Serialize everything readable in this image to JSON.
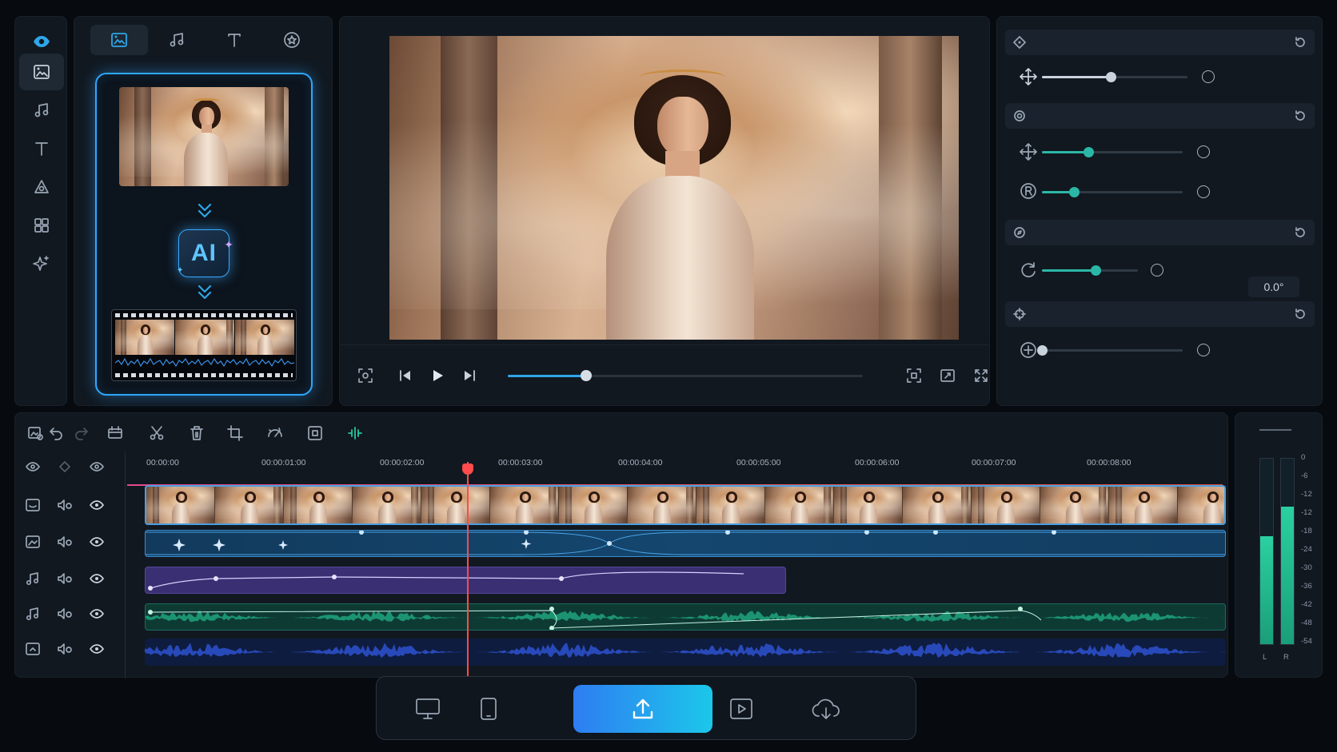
{
  "rail": {
    "items": [
      "eye-icon",
      "media-icon",
      "music-icon",
      "text-icon",
      "effects-icon",
      "templates-icon",
      "sparkle-icon"
    ],
    "active": "media-icon",
    "accent": "#2ea6e8"
  },
  "media_panel": {
    "tabs": [
      "image-icon",
      "music-icon",
      "text-icon",
      "sticker-icon"
    ],
    "active_tab": "image-icon",
    "ai_badge": "AI"
  },
  "timeline": {
    "ruler": [
      "00:00:00",
      "00:00:01:00",
      "00:00:02:00",
      "00:00:03:00",
      "00:00:04:00",
      "00:00:05:00",
      "00:00:06:00",
      "00:00:07:00",
      "00:00:08:00"
    ],
    "tracks": [
      "video",
      "effects",
      "music",
      "audio",
      "voiceover"
    ]
  },
  "properties": {
    "rotation_value": "0.0°",
    "sliders": [
      {
        "name": "position",
        "value": 0.47,
        "color": "#c9d3de"
      },
      {
        "name": "scale",
        "value": 0.33,
        "color": "#2bb7a6"
      },
      {
        "name": "rotate-r",
        "value": 0.23,
        "color": "#2bb7a6"
      },
      {
        "name": "rotation",
        "value": 0.56,
        "color": "#2bb7a6"
      },
      {
        "name": "opacity",
        "value": 0.0,
        "color": "#c9d3de"
      }
    ]
  },
  "meter": {
    "scale": [
      "0",
      "-6",
      "-12",
      "-12",
      "-18",
      "-24",
      "-30",
      "-36",
      "-42",
      "-48",
      "-54"
    ],
    "channels": [
      "L",
      "R"
    ],
    "levels": [
      0.58,
      0.74
    ]
  },
  "playback": {
    "progress": 0.22
  },
  "dock": {
    "items": [
      "desktop-icon",
      "phone-icon",
      "upload-icon",
      "play-icon",
      "cloud-icon"
    ],
    "active": "upload-icon"
  }
}
